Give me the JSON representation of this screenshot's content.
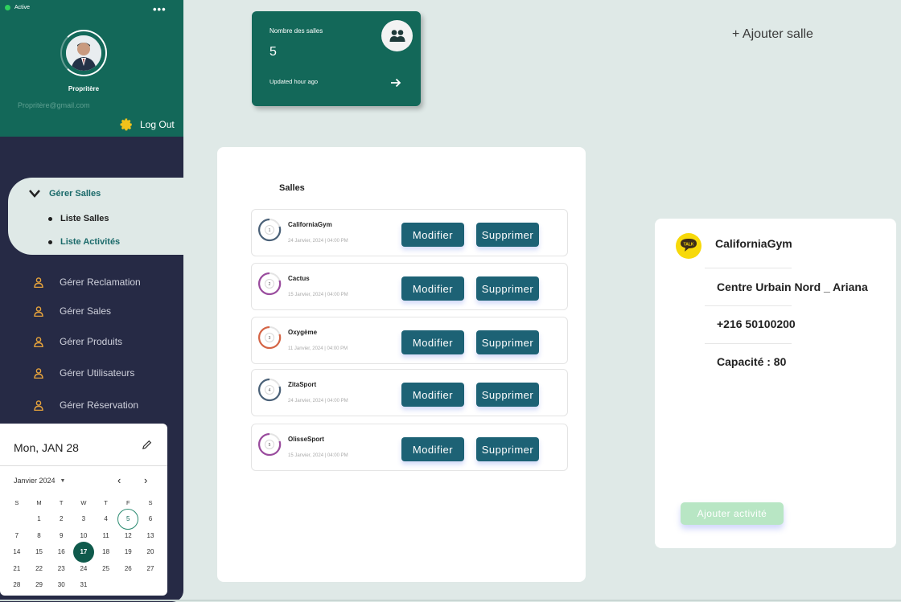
{
  "profile": {
    "status": "Active",
    "more": "•••",
    "name": "Propritère",
    "email": "Propritère@gmail.com",
    "logout_label": "Log Out"
  },
  "sidebar": {
    "active_group": {
      "label": "Gérer Salles",
      "items": [
        {
          "label": "Liste Salles"
        },
        {
          "label": "Liste Activités"
        }
      ]
    },
    "items": [
      {
        "label": "Gérer Reclamation",
        "icon": "person-icon"
      },
      {
        "label": "Gérer Sales",
        "icon": "person-icon"
      },
      {
        "label": "Gérer Produits",
        "icon": "person-icon"
      },
      {
        "label": "Gérer Utilisateurs",
        "icon": "person-icon"
      },
      {
        "label": "Gérer Réservation",
        "icon": "person-icon"
      }
    ]
  },
  "calendar": {
    "date_label": "Mon, JAN 28",
    "month_label": "Janvier 2024",
    "prev": "‹",
    "next": "›",
    "weekdays": [
      "S",
      "M",
      "T",
      "W",
      "T",
      "F",
      "S"
    ],
    "first_weekday_offset": 1,
    "days_in_month": 31,
    "today": 5,
    "selected": 17
  },
  "stats": {
    "label": "Nombre des salles",
    "value": "5",
    "updated": "Updated hour ago"
  },
  "actions": {
    "add_salle": "+ Ajouter salle"
  },
  "salles_panel": {
    "title": "Salles",
    "modify_label": "Modifier",
    "delete_label": "Supprimer",
    "rows": [
      {
        "index": "1",
        "name": "CaliforniaGym",
        "date": "24 Janvier, 2024 | 04:00 PM",
        "color": "#4a6178"
      },
      {
        "index": "2",
        "name": "Cactus",
        "date": "15 Janvier, 2024 | 04:00 PM",
        "color": "#9a4c9e"
      },
      {
        "index": "3",
        "name": "Oxygème",
        "date": "11 Janvier, 2024 | 04:00 PM",
        "color": "#d56546"
      },
      {
        "index": "4",
        "name": "ZitaSport",
        "date": "24 Janvier, 2024 | 04:00 PM",
        "color": "#4a6178"
      },
      {
        "index": "5",
        "name": "OlisseSport",
        "date": "15 Janvier, 2024 | 04:00 PM",
        "color": "#9a4c9e"
      }
    ]
  },
  "detail": {
    "name": "CaliforniaGym",
    "badge": "TALK",
    "address": "Centre Urbain Nord _ Ariana",
    "phone": "+216 50100200",
    "capacity": "Capacité : 80",
    "add_activity": "Ajouter activité"
  },
  "colors": {
    "primary": "#136859",
    "sidebar": "#262a45",
    "button": "#1d6275",
    "background": "#dfe9e7",
    "add_activity": "#b8e6c4"
  }
}
